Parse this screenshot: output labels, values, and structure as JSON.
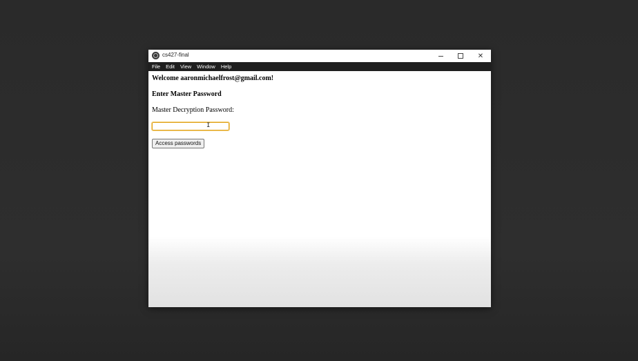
{
  "window": {
    "title": "cs427-final",
    "controls": {
      "minimize": "minimize",
      "maximize": "maximize",
      "close": "✕"
    }
  },
  "menu": [
    "File",
    "Edit",
    "View",
    "Window",
    "Help"
  ],
  "content": {
    "welcome": "Welcome aaronmichaelfrost@gmail.com!",
    "heading": "Enter Master Password",
    "password_label": "Master Decryption Password:",
    "password_value": "",
    "button_label": "Access passwords"
  },
  "colors": {
    "desktop": "#2b2b2b",
    "menubar": "#1f1f1f",
    "input_focus": "#e0a21b"
  }
}
